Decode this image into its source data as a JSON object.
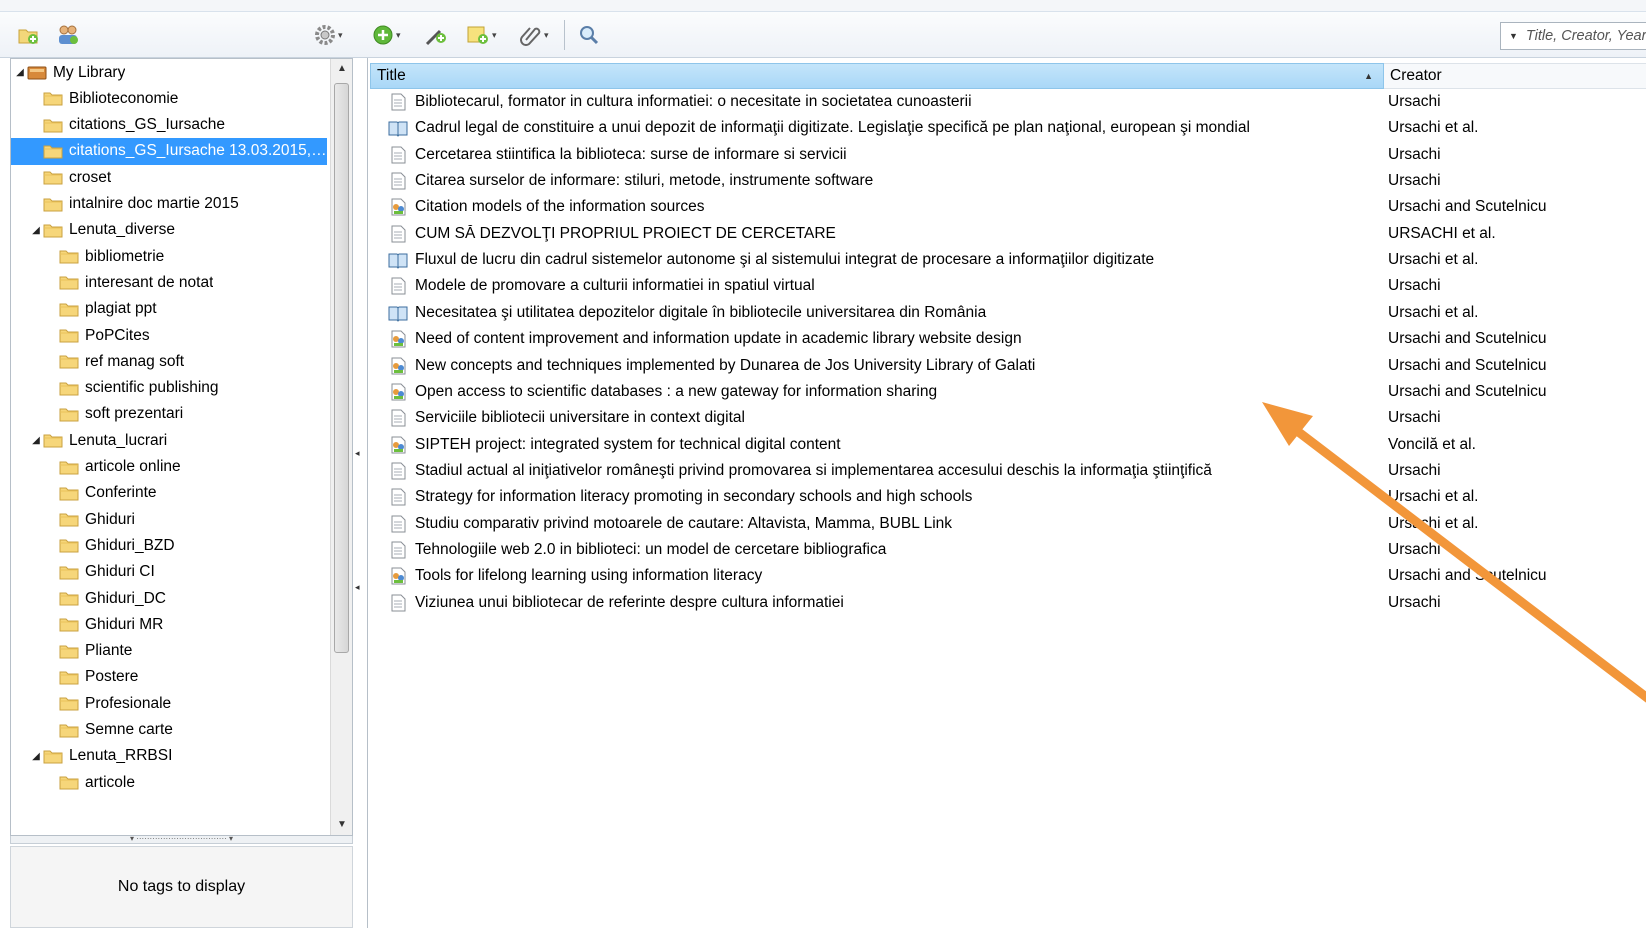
{
  "search": {
    "placeholder": "Title, Creator, Year"
  },
  "tree": [
    {
      "label": "My Library",
      "level": 0,
      "twisty": "expanded",
      "icon": "library"
    },
    {
      "label": "Biblioteconomie",
      "level": 1,
      "icon": "folder"
    },
    {
      "label": "citations_GS_Iursache",
      "level": 1,
      "icon": "folder"
    },
    {
      "label": "citations_GS_Iursache 13.03.2015, ...",
      "level": 1,
      "icon": "folder",
      "selected": true
    },
    {
      "label": "croset",
      "level": 1,
      "icon": "folder"
    },
    {
      "label": "intalnire doc martie 2015",
      "level": 1,
      "icon": "folder"
    },
    {
      "label": "Lenuta_diverse",
      "level": 1,
      "twisty": "expanded",
      "icon": "folder"
    },
    {
      "label": "bibliometrie",
      "level": 2,
      "icon": "folder"
    },
    {
      "label": "interesant de notat",
      "level": 2,
      "icon": "folder"
    },
    {
      "label": "plagiat ppt",
      "level": 2,
      "icon": "folder"
    },
    {
      "label": "PoPCites",
      "level": 2,
      "icon": "folder"
    },
    {
      "label": "ref manag soft",
      "level": 2,
      "icon": "folder"
    },
    {
      "label": "scientific publishing",
      "level": 2,
      "icon": "folder"
    },
    {
      "label": "soft prezentari",
      "level": 2,
      "icon": "folder"
    },
    {
      "label": "Lenuta_lucrari",
      "level": 1,
      "twisty": "expanded",
      "icon": "folder"
    },
    {
      "label": "articole online",
      "level": 2,
      "icon": "folder"
    },
    {
      "label": "Conferinte",
      "level": 2,
      "icon": "folder"
    },
    {
      "label": "Ghiduri",
      "level": 2,
      "icon": "folder"
    },
    {
      "label": "Ghiduri_BZD",
      "level": 2,
      "icon": "folder"
    },
    {
      "label": "Ghiduri CI",
      "level": 2,
      "icon": "folder"
    },
    {
      "label": "Ghiduri_DC",
      "level": 2,
      "icon": "folder"
    },
    {
      "label": "Ghiduri MR",
      "level": 2,
      "icon": "folder"
    },
    {
      "label": "Pliante",
      "level": 2,
      "icon": "folder"
    },
    {
      "label": "Postere",
      "level": 2,
      "icon": "folder"
    },
    {
      "label": "Profesionale",
      "level": 2,
      "icon": "folder"
    },
    {
      "label": "Semne carte",
      "level": 2,
      "icon": "folder"
    },
    {
      "label": "Lenuta_RRBSI",
      "level": 1,
      "twisty": "expanded",
      "icon": "folder"
    },
    {
      "label": "articole",
      "level": 2,
      "icon": "folder"
    }
  ],
  "tags": {
    "empty_text": "No tags to display"
  },
  "items": {
    "columns": {
      "title": "Title",
      "creator": "Creator"
    },
    "rows": [
      {
        "type": "document-icon",
        "title": "Bibliotecarul, formator in cultura informatiei: o necesitate in societatea cunoasterii",
        "creator": "Ursachi"
      },
      {
        "type": "book-icon",
        "title": "Cadrul legal de constituire a unui depozit de informaţii digitizate. Legislaţie specifică pe plan naţional, european şi mondial",
        "creator": "Ursachi et al."
      },
      {
        "type": "document-icon",
        "title": "Cercetarea stiintifica la biblioteca: surse de informare si servicii",
        "creator": "Ursachi"
      },
      {
        "type": "document-icon",
        "title": "Citarea surselor de informare: stiluri, metode, instrumente software",
        "creator": "Ursachi"
      },
      {
        "type": "conference-paper-icon",
        "title": "Citation models of the information sources",
        "creator": "Ursachi and Scutelnicu"
      },
      {
        "type": "document-icon",
        "title": "CUM SĂ DEZVOLŢI PROPRIUL PROIECT DE CERCETARE",
        "creator": "URSACHI et al."
      },
      {
        "type": "book-icon",
        "title": "Fluxul de lucru din cadrul sistemelor autonome şi al sistemului integrat de procesare a informaţiilor digitizate",
        "creator": "Ursachi et al."
      },
      {
        "type": "document-icon",
        "title": "Modele de promovare a culturii informatiei in spatiul virtual",
        "creator": "Ursachi"
      },
      {
        "type": "book-icon",
        "title": "Necesitatea şi utilitatea depozitelor digitale în bibliotecile universitarea din România",
        "creator": "Ursachi et al."
      },
      {
        "type": "conference-paper-icon",
        "title": "Need of content improvement and information update in academic library website design",
        "creator": "Ursachi and Scutelnicu"
      },
      {
        "type": "conference-paper-icon",
        "title": "New concepts and techniques implemented by Dunarea de Jos University Library of Galati",
        "creator": "Ursachi and Scutelnicu"
      },
      {
        "type": "conference-paper-icon",
        "title": "Open access to scientific databases : a new gateway for information sharing",
        "creator": "Ursachi and Scutelnicu"
      },
      {
        "type": "document-icon",
        "title": "Serviciile bibliotecii universitare in context digital",
        "creator": "Ursachi"
      },
      {
        "type": "conference-paper-icon",
        "title": "SIPTEH project: integrated system for technical digital content",
        "creator": "Voncilă et al."
      },
      {
        "type": "document-icon",
        "title": "Stadiul actual al iniţiativelor româneşti privind promovarea si implementarea accesului deschis la informaţia ştiinţifică",
        "creator": "Ursachi"
      },
      {
        "type": "document-icon",
        "title": "Strategy for information literacy promoting in secondary schools and high schools",
        "creator": "Ursachi et al."
      },
      {
        "type": "document-icon",
        "title": "Studiu comparativ privind motoarele de cautare: Altavista, Mamma, BUBL Link",
        "creator": "Ursachi et al."
      },
      {
        "type": "document-icon",
        "title": "Tehnologiile web 2.0 in biblioteci: un model de cercetare bibliografica",
        "creator": "Ursachi"
      },
      {
        "type": "conference-paper-icon",
        "title": "Tools for lifelong learning using information literacy",
        "creator": "Ursachi and Scutelnicu"
      },
      {
        "type": "document-icon",
        "title": "Viziunea unui bibliotecar de referinte despre cultura informatiei",
        "creator": "Ursachi"
      }
    ]
  },
  "annotation": {
    "arrow_color": "#f2963a"
  },
  "colors": {
    "selection": "#3399ff",
    "header": "#b8def8"
  }
}
